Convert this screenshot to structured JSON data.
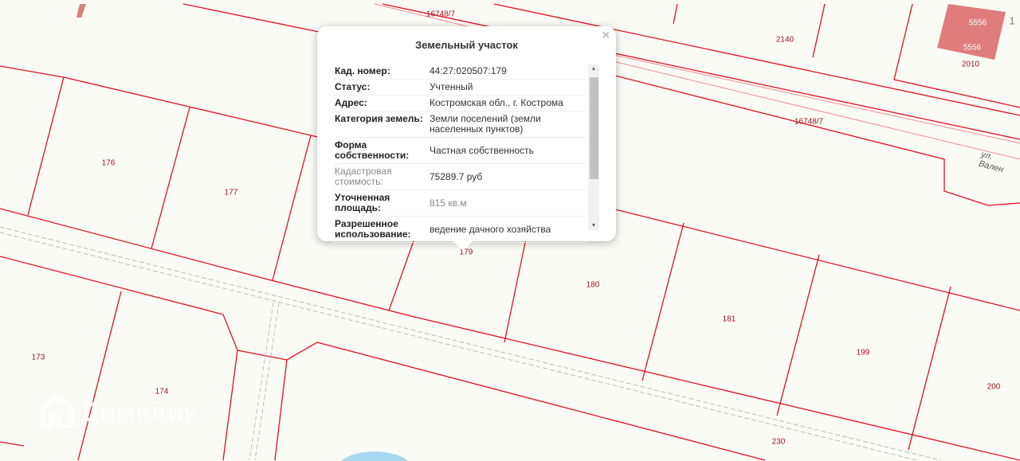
{
  "map": {
    "parcels": [
      "16748/7",
      "2140",
      "5556",
      "5556",
      "2010",
      "16748/7",
      "176",
      "177",
      "179",
      "180",
      "181",
      "199",
      "173",
      "174",
      "200",
      "230",
      "1"
    ],
    "street": "ул. Вален",
    "watermark": "Домклик",
    "colors": {
      "boundary": "#e0101e",
      "highlight": "#e07c7c",
      "background": "#fbfbf6"
    }
  },
  "popup": {
    "title": "Земельный участок",
    "close": "×",
    "rows": [
      {
        "key": "Кад. номер:",
        "value": "44:27:020507:179"
      },
      {
        "key": "Статус:",
        "value": "Учтенный"
      },
      {
        "key": "Адрес:",
        "value": "Костромская обл., г. Кострома"
      },
      {
        "key": "Категория земель:",
        "value": "Земли поселений (земли населенных пунктов)"
      },
      {
        "key": "Форма собственности:",
        "value": "Частная собственность"
      },
      {
        "key": "Кадастровая стоимость:",
        "value": "75289.7 руб"
      },
      {
        "key": "Уточненная площадь:",
        "value": "815 кв.м"
      },
      {
        "key": "Разрешенное использование:",
        "value": "ведение дачного хозяйства"
      }
    ]
  }
}
